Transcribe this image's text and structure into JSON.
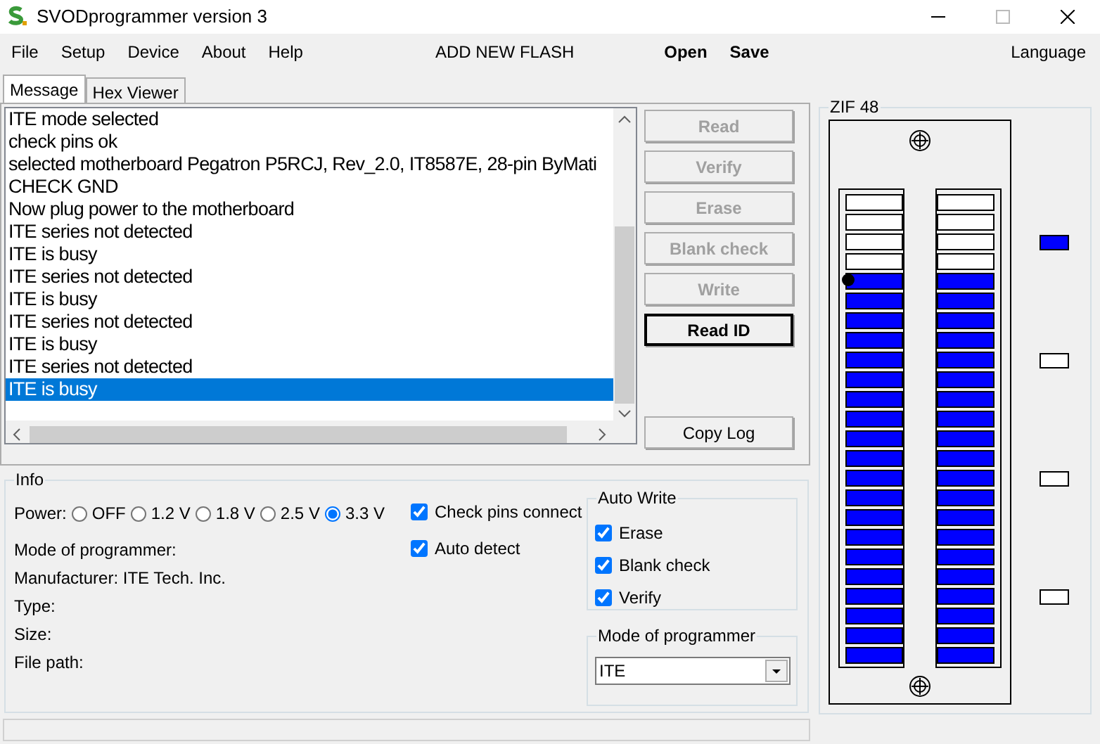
{
  "window": {
    "title": "SVODprogrammer version 3"
  },
  "menu": [
    {
      "label": "File",
      "kind": "plain"
    },
    {
      "label": "Setup",
      "kind": "plain"
    },
    {
      "label": "Device",
      "kind": "plain"
    },
    {
      "label": "About",
      "kind": "plain"
    },
    {
      "label": "Help",
      "kind": "plain"
    },
    {
      "label": "ADD NEW FLASH",
      "kind": "center"
    },
    {
      "label": "Open",
      "kind": "bold"
    },
    {
      "label": "Save",
      "kind": "bold"
    },
    {
      "label": "Language",
      "kind": "right"
    }
  ],
  "tabs": [
    {
      "label": "Message",
      "selected": true
    },
    {
      "label": "Hex Viewer",
      "selected": false
    }
  ],
  "log": [
    {
      "text": "ITE mode selected",
      "selected": false
    },
    {
      "text": "check pins ok",
      "selected": false
    },
    {
      "text": "selected motherboard Pegatron P5RCJ, Rev_2.0, IT8587E, 28-pin ByMati",
      "selected": false
    },
    {
      "text": "CHECK GND",
      "selected": false
    },
    {
      "text": "Now plug power to the motherboard",
      "selected": false
    },
    {
      "text": "ITE series not detected",
      "selected": false
    },
    {
      "text": "ITE is busy",
      "selected": false
    },
    {
      "text": "ITE series not detected",
      "selected": false
    },
    {
      "text": "ITE is busy",
      "selected": false
    },
    {
      "text": "ITE series not detected",
      "selected": false
    },
    {
      "text": "ITE is busy",
      "selected": false
    },
    {
      "text": "ITE series not detected",
      "selected": false
    },
    {
      "text": "ITE is busy",
      "selected": true
    }
  ],
  "actions": [
    {
      "label": "Read",
      "disabled": true,
      "default": false
    },
    {
      "label": "Verify",
      "disabled": true,
      "default": false
    },
    {
      "label": "Erase",
      "disabled": true,
      "default": false
    },
    {
      "label": "Blank check",
      "disabled": true,
      "default": false
    },
    {
      "label": "Write",
      "disabled": true,
      "default": false
    },
    {
      "label": "Read ID",
      "disabled": false,
      "default": true
    }
  ],
  "copy_log": {
    "label": "Copy Log"
  },
  "info": {
    "title": "Info",
    "power_label": "Power:",
    "power_options": [
      {
        "label": "OFF",
        "selected": false
      },
      {
        "label": "1.2 V",
        "selected": false
      },
      {
        "label": "1.8 V",
        "selected": false
      },
      {
        "label": "2.5 V",
        "selected": false
      },
      {
        "label": "3.3 V",
        "selected": true
      }
    ],
    "fields": [
      "Mode of programmer:",
      "Manufacturer: ITE Tech. Inc.",
      "Type:",
      "Size:",
      "File path:"
    ],
    "options": [
      {
        "label": "Check pins connect",
        "checked": true
      },
      {
        "label": "Auto detect",
        "checked": true
      }
    ],
    "auto_write": {
      "title": "Auto Write",
      "items": [
        {
          "label": "Erase",
          "checked": true
        },
        {
          "label": "Blank check",
          "checked": true
        },
        {
          "label": "Verify",
          "checked": true
        }
      ]
    },
    "mode": {
      "title": "Mode of programmer",
      "value": "ITE"
    }
  },
  "zif": {
    "title": "ZIF 48",
    "columns": [
      {
        "pins": [
          {
            "on": false,
            "marked": false
          },
          {
            "on": false,
            "marked": false
          },
          {
            "on": false,
            "marked": false
          },
          {
            "on": false,
            "marked": false
          },
          {
            "on": true,
            "marked": true
          },
          {
            "on": true,
            "marked": false
          },
          {
            "on": true,
            "marked": false
          },
          {
            "on": true,
            "marked": false
          },
          {
            "on": true,
            "marked": false
          },
          {
            "on": true,
            "marked": false
          },
          {
            "on": true,
            "marked": false
          },
          {
            "on": true,
            "marked": false
          },
          {
            "on": true,
            "marked": false
          },
          {
            "on": true,
            "marked": false
          },
          {
            "on": true,
            "marked": false
          },
          {
            "on": true,
            "marked": false
          },
          {
            "on": true,
            "marked": false
          },
          {
            "on": true,
            "marked": false
          },
          {
            "on": true,
            "marked": false
          },
          {
            "on": true,
            "marked": false
          },
          {
            "on": true,
            "marked": false
          },
          {
            "on": true,
            "marked": false
          },
          {
            "on": true,
            "marked": false
          },
          {
            "on": true,
            "marked": false
          }
        ]
      },
      {
        "pins": [
          {
            "on": false,
            "marked": false
          },
          {
            "on": false,
            "marked": false
          },
          {
            "on": false,
            "marked": false
          },
          {
            "on": false,
            "marked": false
          },
          {
            "on": true,
            "marked": false
          },
          {
            "on": true,
            "marked": false
          },
          {
            "on": true,
            "marked": false
          },
          {
            "on": true,
            "marked": false
          },
          {
            "on": true,
            "marked": false
          },
          {
            "on": true,
            "marked": false
          },
          {
            "on": true,
            "marked": false
          },
          {
            "on": true,
            "marked": false
          },
          {
            "on": true,
            "marked": false
          },
          {
            "on": true,
            "marked": false
          },
          {
            "on": true,
            "marked": false
          },
          {
            "on": true,
            "marked": false
          },
          {
            "on": true,
            "marked": false
          },
          {
            "on": true,
            "marked": false
          },
          {
            "on": true,
            "marked": false
          },
          {
            "on": true,
            "marked": false
          },
          {
            "on": true,
            "marked": false
          },
          {
            "on": true,
            "marked": false
          },
          {
            "on": true,
            "marked": false
          },
          {
            "on": true,
            "marked": false
          }
        ]
      }
    ],
    "indicators": [
      {
        "on": true
      },
      {
        "on": false
      },
      {
        "on": false
      },
      {
        "on": false
      }
    ]
  }
}
